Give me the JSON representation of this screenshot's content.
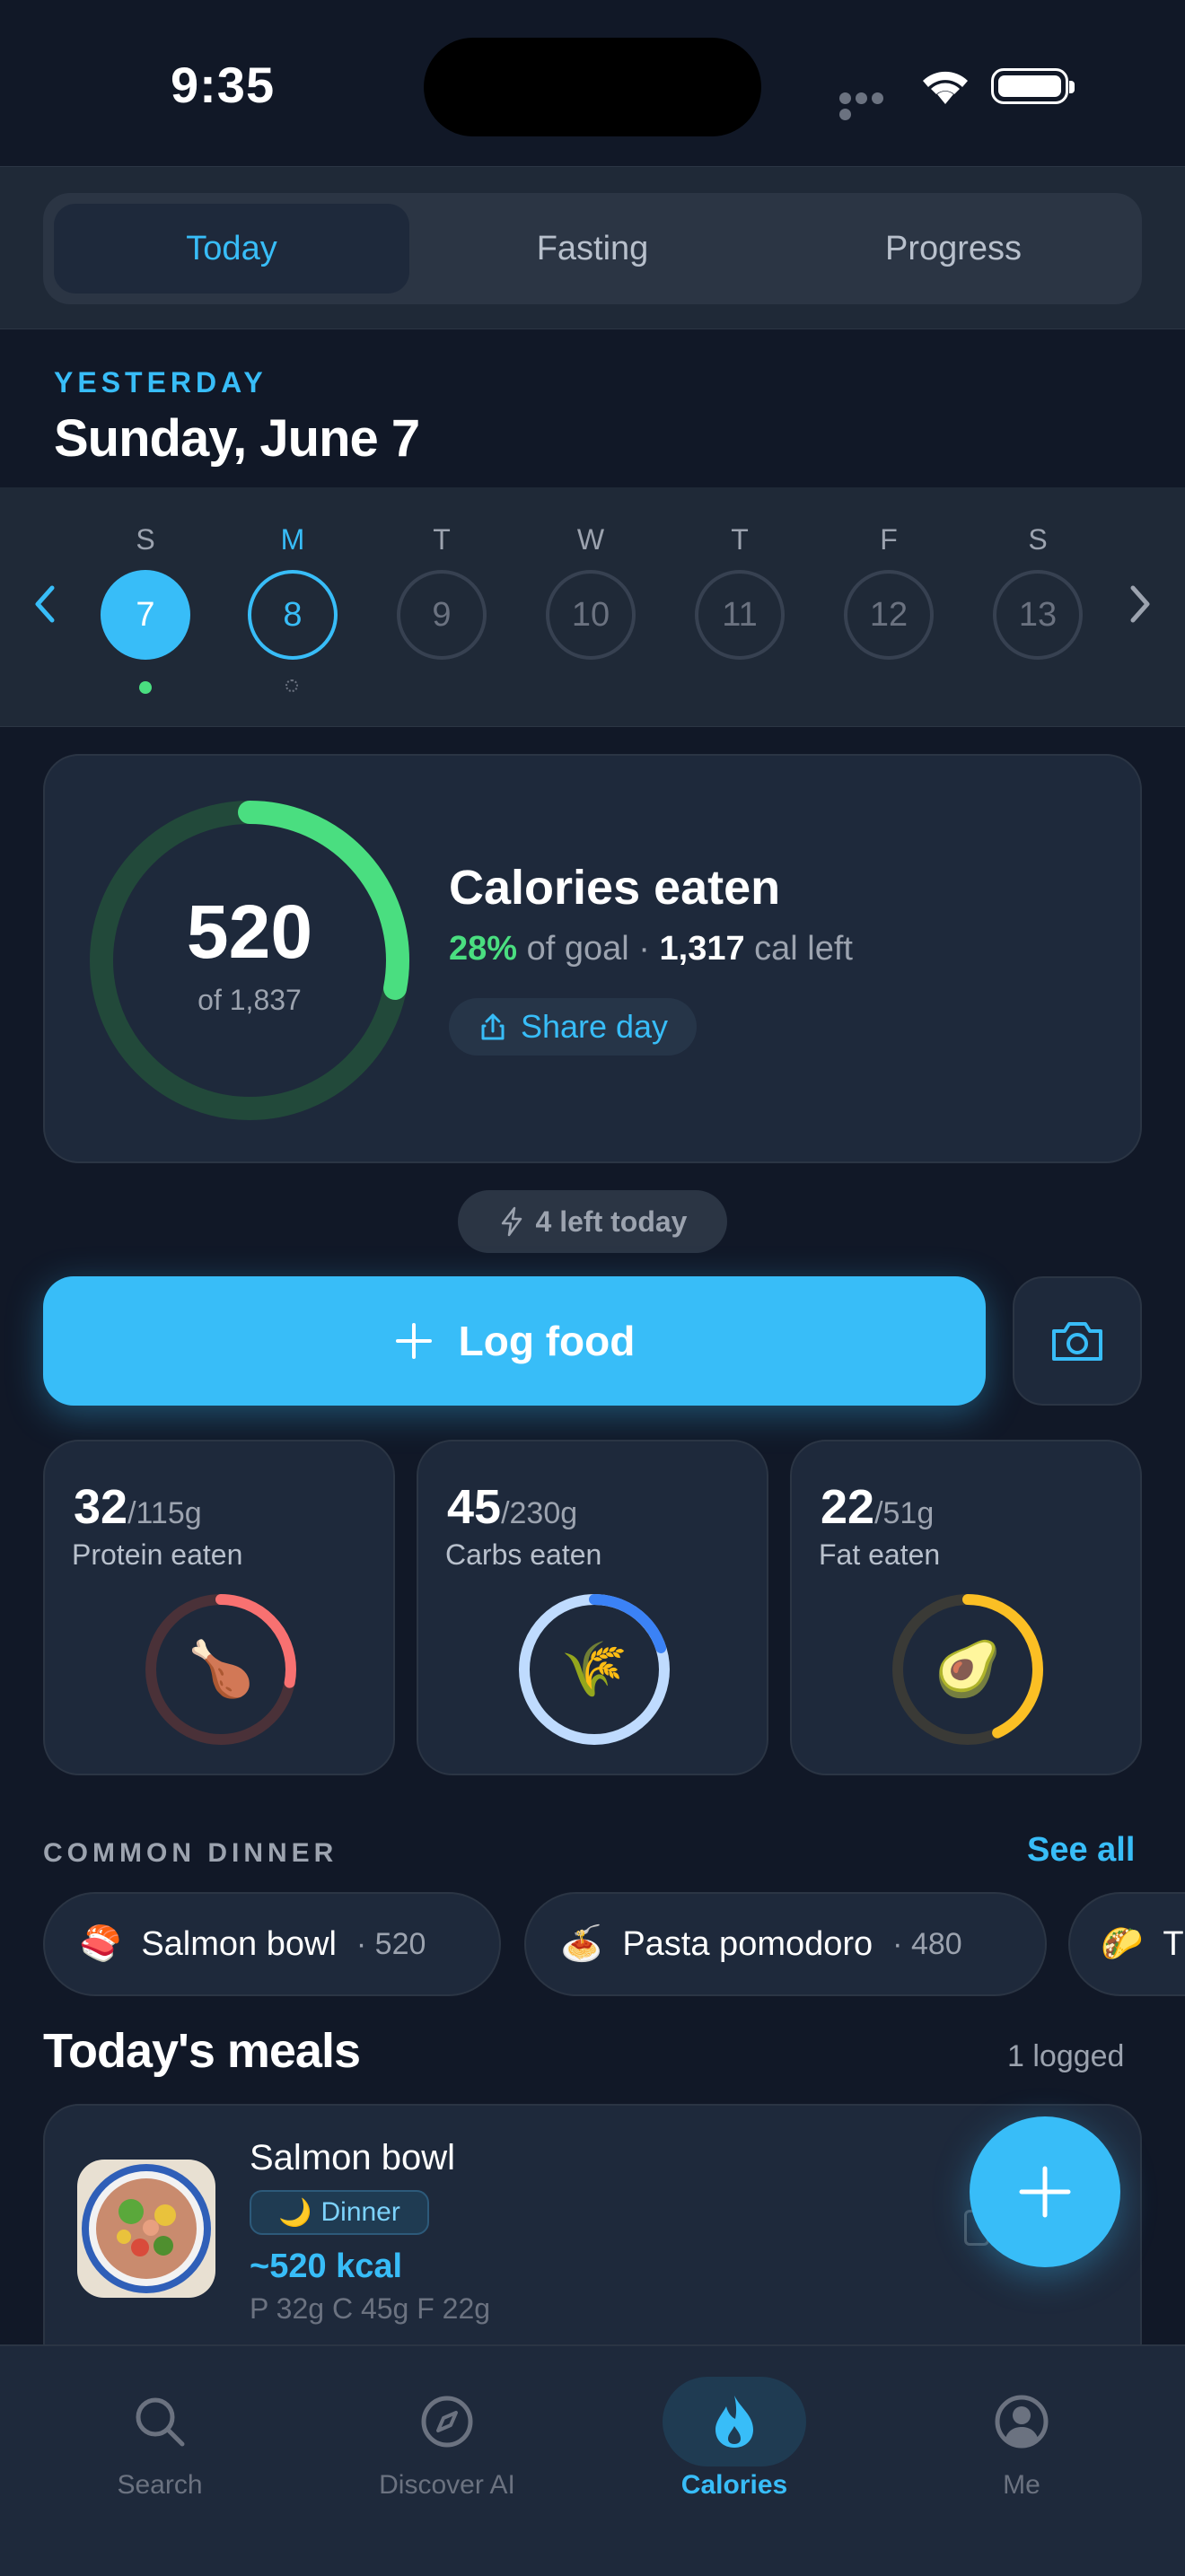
{
  "status_bar": {
    "time": "9:35"
  },
  "segments": [
    {
      "label": "Today",
      "active": true
    },
    {
      "label": "Fasting",
      "active": false
    },
    {
      "label": "Progress",
      "active": false
    }
  ],
  "date_header": {
    "eyebrow": "YESTERDAY",
    "title": "Sunday, June 7"
  },
  "week": {
    "days": [
      {
        "letter": "S",
        "num": "7",
        "state": "selected",
        "marker": "logged"
      },
      {
        "letter": "M",
        "num": "8",
        "state": "today",
        "marker": "pending"
      },
      {
        "letter": "T",
        "num": "9",
        "state": "none",
        "marker": ""
      },
      {
        "letter": "W",
        "num": "10",
        "state": "none",
        "marker": ""
      },
      {
        "letter": "T",
        "num": "11",
        "state": "none",
        "marker": ""
      },
      {
        "letter": "F",
        "num": "12",
        "state": "none",
        "marker": ""
      },
      {
        "letter": "S",
        "num": "13",
        "state": "none",
        "marker": ""
      }
    ]
  },
  "calories": {
    "eaten": "520",
    "of_goal": "of 1,837",
    "title": "Calories eaten",
    "percent": "28%",
    "percent_suffix": "of goal ·",
    "left_value": "1,317",
    "left_suffix": "cal left",
    "progress_fraction": 0.28,
    "share_label": "Share day"
  },
  "quota_pill": "4 left today",
  "log_food_label": "Log food",
  "macros": [
    {
      "value": "32",
      "goal": "/115g",
      "label": "Protein eaten",
      "fraction": 0.28,
      "color": "#f87171",
      "track": "#4a3138",
      "emoji": "🍗"
    },
    {
      "value": "45",
      "goal": "/230g",
      "label": "Carbs eaten",
      "fraction": 0.2,
      "color": "#3b82f6",
      "track": "#bfdbfe",
      "emoji": "🌾"
    },
    {
      "value": "22",
      "goal": "/51g",
      "label": "Fat eaten",
      "fraction": 0.43,
      "color": "#fbbf24",
      "track": "#3a3a36",
      "emoji": "🥑"
    }
  ],
  "common": {
    "heading": "COMMON DINNER",
    "see_all": "See all",
    "chips": [
      {
        "emoji": "🍣",
        "name": "Salmon bowl",
        "cal": "· 520"
      },
      {
        "emoji": "🍝",
        "name": "Pasta pomodoro",
        "cal": "· 480"
      },
      {
        "emoji": "🌮",
        "name": "T",
        "cal": ""
      }
    ]
  },
  "meals": {
    "title": "Today's meals",
    "count": "1 logged",
    "items": [
      {
        "name": "Salmon bowl",
        "badge": "Dinner",
        "badge_emoji": "🌙",
        "kcal": "~520 kcal",
        "macros": "P 32g  C 45g  F 22g"
      }
    ]
  },
  "tabs": [
    {
      "label": "Search",
      "icon": "search-icon",
      "active": false
    },
    {
      "label": "Discover AI",
      "icon": "compass-icon",
      "active": false
    },
    {
      "label": "Calories",
      "icon": "flame-icon",
      "active": true
    },
    {
      "label": "Me",
      "icon": "profile-icon",
      "active": false
    }
  ],
  "colors": {
    "accent": "#38bdf8",
    "success": "#4ade80",
    "background": "#111827",
    "card": "#1e293b"
  }
}
